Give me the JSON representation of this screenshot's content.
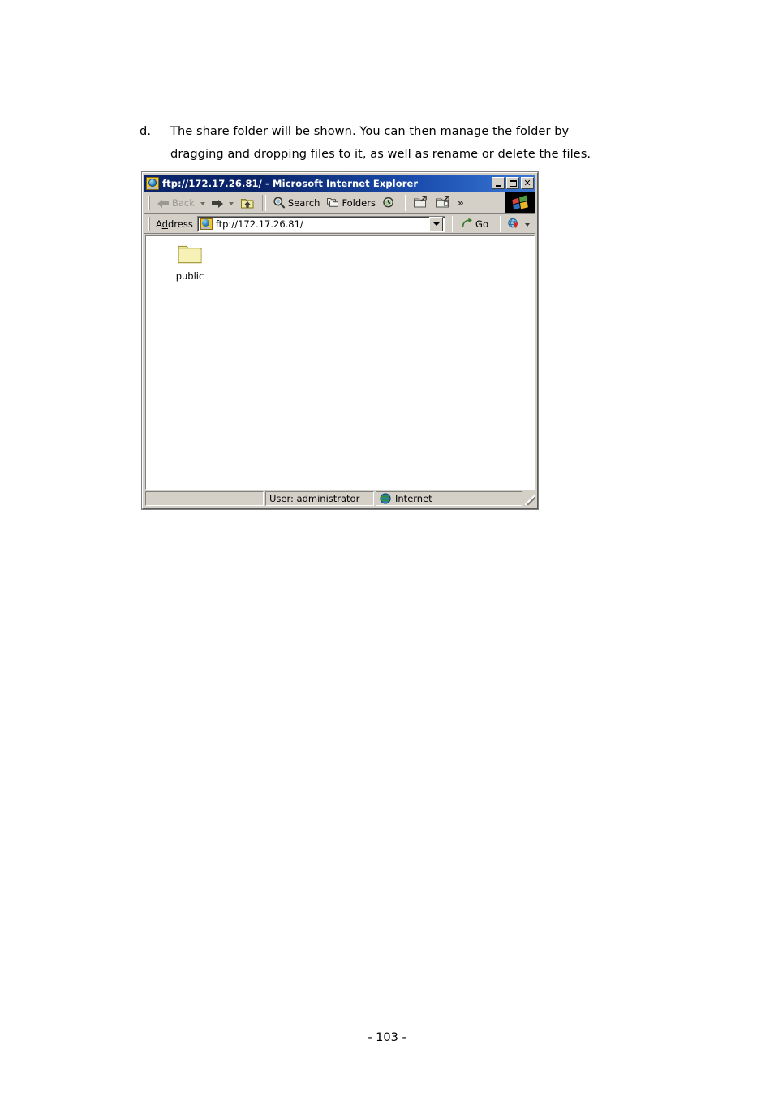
{
  "document": {
    "paragraph": {
      "marker": "d.",
      "line1": "The share folder will be shown.  You can then manage the folder by",
      "line2": "dragging and dropping files to it, as well as rename or delete the files."
    },
    "page_number": "- 103 -"
  },
  "screenshot": {
    "window": {
      "title": "ftp://172.17.26.81/ - Microsoft Internet Explorer",
      "title_icon": "ie-ftp-folder-icon",
      "buttons": {
        "minimize": "Minimize",
        "maximize": "Maximize",
        "close": "Close"
      }
    },
    "toolbar": {
      "back_label": "Back",
      "back_enabled": false,
      "forward_label": "Forward",
      "up_label": "Up",
      "search_label": "Search",
      "folders_label": "Folders",
      "history_label": "History",
      "move_to_label": "Move To",
      "copy_to_label": "Copy To",
      "overflow_label": "»",
      "brand_logo": "windows-flag-logo"
    },
    "address_bar": {
      "label": "Address",
      "label_accesskey": "d",
      "value": "ftp://172.17.26.81/",
      "favicon": "ie-ftp-folder-icon",
      "dropdown": "History dropdown",
      "go_label": "Go",
      "links_label": "Links"
    },
    "content": {
      "items": [
        {
          "name": "public",
          "icon": "folder-icon",
          "type": "folder"
        }
      ]
    },
    "status_bar": {
      "panel1": "",
      "panel2": "User: administrator",
      "panel3": "Internet",
      "zone_icon": "internet-zone-globe-icon"
    }
  },
  "colors": {
    "title_gradient_start": "#0a246a",
    "title_gradient_end": "#3a78d4",
    "window_face": "#d4d0c8",
    "content_bg": "#ffffff",
    "folder_fill": "#f5edA8",
    "folder_stroke": "#a09a3c",
    "page_text": "#000000"
  }
}
